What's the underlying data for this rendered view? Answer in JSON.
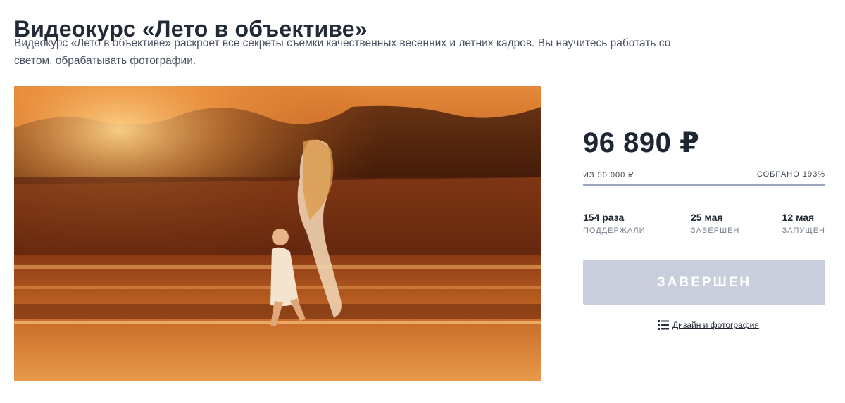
{
  "page": {
    "title": "Видеокурс «Лето в объективе»",
    "description": "Видеокурс «Лето в объективе» раскроет все секреты съёмки качественных весенних и летних кадров. Вы научитесь работать со светом, обрабатывать фотографии."
  },
  "hero_image": {
    "icon": "photo-mother-and-child-running-on-water-at-sunset"
  },
  "funding": {
    "amount": "96 890 ₽",
    "goal": "из 50 000 ₽",
    "collected": "собрано 193%",
    "progress_fraction": 1.0
  },
  "stats": [
    {
      "value": "154 раза",
      "label": "ПОДДЕРЖАЛИ"
    },
    {
      "value": "25 мая",
      "label": "ЗАВЕРШЕН"
    },
    {
      "value": "12 мая",
      "label": "ЗАПУЩЕН"
    }
  ],
  "status_button": {
    "label": "ЗАВЕРШЕН"
  },
  "category": {
    "label": "Дизайн и фотография",
    "icon": "list-icon"
  },
  "colors": {
    "button_bg": "#c8cedc",
    "progress_fill": "#9aa6ba",
    "title": "#222a36"
  }
}
